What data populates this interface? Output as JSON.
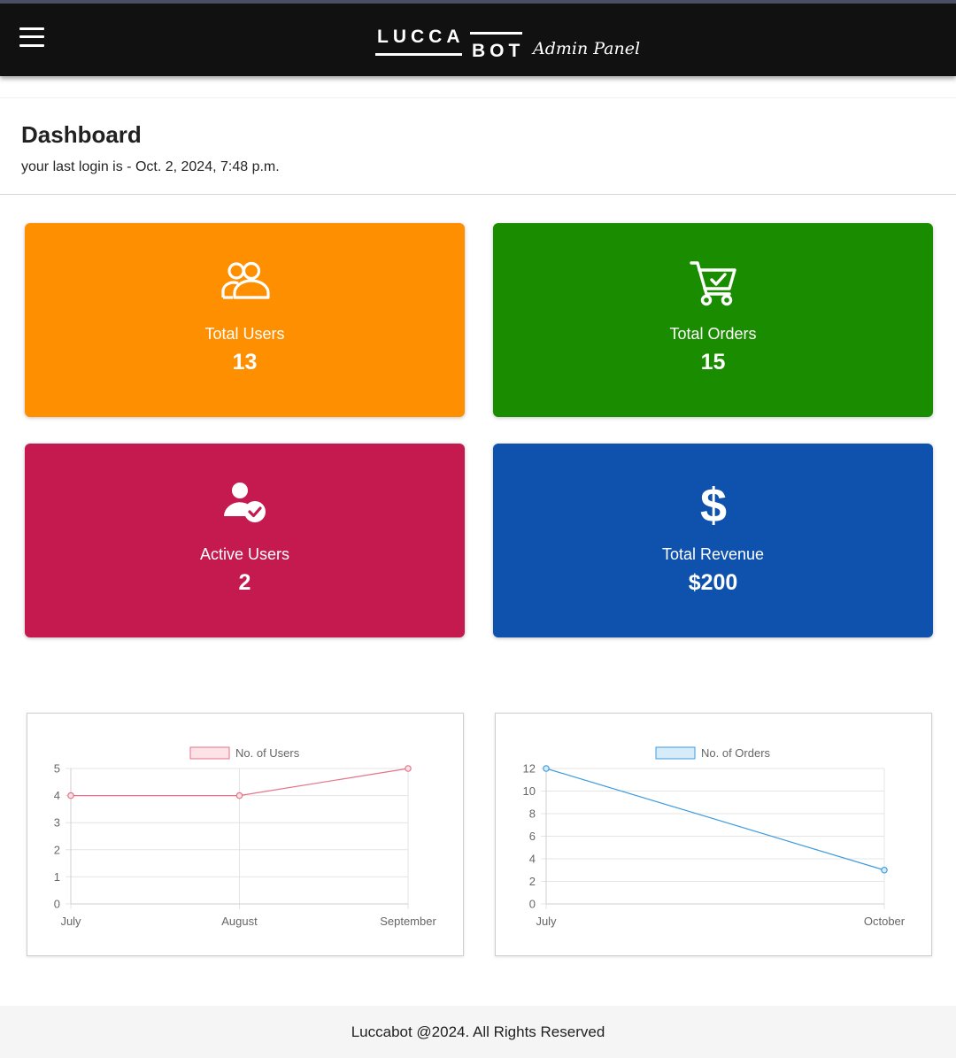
{
  "header": {
    "logo_word1": "LUCCA",
    "logo_word2": "BOT",
    "logo_subtitle": "Admin Panel",
    "menu_icon": "hamburger-menu-icon"
  },
  "dashboard": {
    "title": "Dashboard",
    "last_login": "your last login is - Oct. 2, 2024, 7:48 p.m."
  },
  "cards": [
    {
      "label": "Total Users",
      "value": "13",
      "icon": "users-icon",
      "color": "#fe8f00"
    },
    {
      "label": "Total Orders",
      "value": "15",
      "icon": "cart-check-icon",
      "color": "#1a8c00"
    },
    {
      "label": "Active Users",
      "value": "2",
      "icon": "user-check-icon",
      "color": "#c41a50"
    },
    {
      "label": "Total Revenue",
      "value": "$200",
      "icon": "dollar-icon",
      "color": "#0f52ad"
    }
  ],
  "chart_data": [
    {
      "type": "line",
      "categories": [
        "July",
        "August",
        "September"
      ],
      "series": [
        {
          "name": "No. of Users",
          "values": [
            4,
            4,
            5
          ],
          "color": "#e57389",
          "fill": "#fde2e6"
        }
      ],
      "ylim": [
        0,
        5
      ],
      "yticks": [
        0,
        1,
        2,
        3,
        4,
        5
      ],
      "grid": true,
      "legend": "top"
    },
    {
      "type": "line",
      "categories": [
        "July",
        "October"
      ],
      "series": [
        {
          "name": "No. of Orders",
          "values": [
            12,
            3
          ],
          "color": "#3d9be0",
          "fill": "#d7ecfb"
        }
      ],
      "ylim": [
        0,
        12
      ],
      "yticks": [
        0,
        2,
        4,
        6,
        8,
        10,
        12
      ],
      "grid": true,
      "legend": "top"
    }
  ],
  "footer": {
    "text": "Luccabot @2024. All Rights Reserved"
  }
}
